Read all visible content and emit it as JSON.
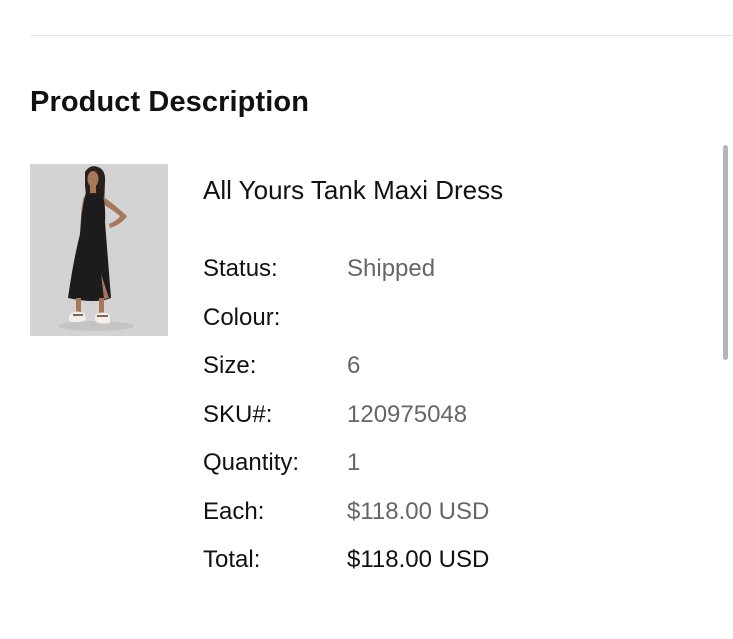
{
  "section": {
    "title": "Product Description"
  },
  "product": {
    "name": "All Yours Tank Maxi Dress",
    "image_icon": "product-photo",
    "details": [
      {
        "label": "Status:",
        "value": "Shipped"
      },
      {
        "label": "Colour:",
        "value": ""
      },
      {
        "label": "Size:",
        "value": "6"
      },
      {
        "label": "SKU#:",
        "value": "120975048"
      },
      {
        "label": "Quantity:",
        "value": "1"
      },
      {
        "label": "Each:",
        "value": "$118.00 USD"
      },
      {
        "label": "Total:",
        "value": "$118.00 USD"
      }
    ]
  },
  "colors": {
    "label_text": "#111111",
    "value_text": "#666666",
    "image_background": "#d3d3d3",
    "divider": "#e3e3e3",
    "scrollbar": "#b5b5b5"
  }
}
